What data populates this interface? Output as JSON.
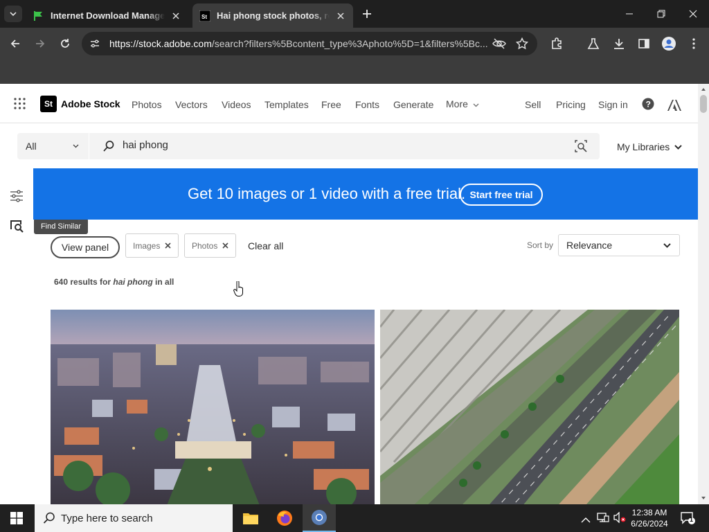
{
  "browser": {
    "tabs": [
      {
        "title": "Internet Download Manager is",
        "active": false
      },
      {
        "title": "Hai phong stock photos, royalty",
        "active": true
      }
    ],
    "url_host": "https://stock.adobe.com",
    "url_path": "/search?filters%5Bcontent_type%3Aphoto%5D=1&filters%5Bc..."
  },
  "header": {
    "logo_box": "St",
    "logo_text": "Adobe Stock",
    "nav": [
      "Photos",
      "Vectors",
      "Videos",
      "Templates",
      "Free",
      "Fonts",
      "Generate",
      "More"
    ],
    "right": [
      "Sell",
      "Pricing",
      "Sign in"
    ]
  },
  "search": {
    "scope": "All",
    "query": "hai phong",
    "libraries": "My Libraries"
  },
  "banner": {
    "text": "Get 10 images or 1 video with a free trial.",
    "button": "Start free trial",
    "color": "#1473e6"
  },
  "sidebar": {
    "tooltip": "Find Similar"
  },
  "filters": {
    "view_panel": "View panel",
    "chips": [
      "Images",
      "Photos"
    ],
    "clear_all": "Clear all",
    "sort_label": "Sort by",
    "sort_value": "Relevance"
  },
  "results": {
    "count_prefix": "640 results for ",
    "query": "hai phong",
    "count_suffix": " in all"
  },
  "taskbar": {
    "search_placeholder": "Type here to search",
    "time": "12:38 AM",
    "date": "6/26/2024",
    "notification_count": "1"
  }
}
